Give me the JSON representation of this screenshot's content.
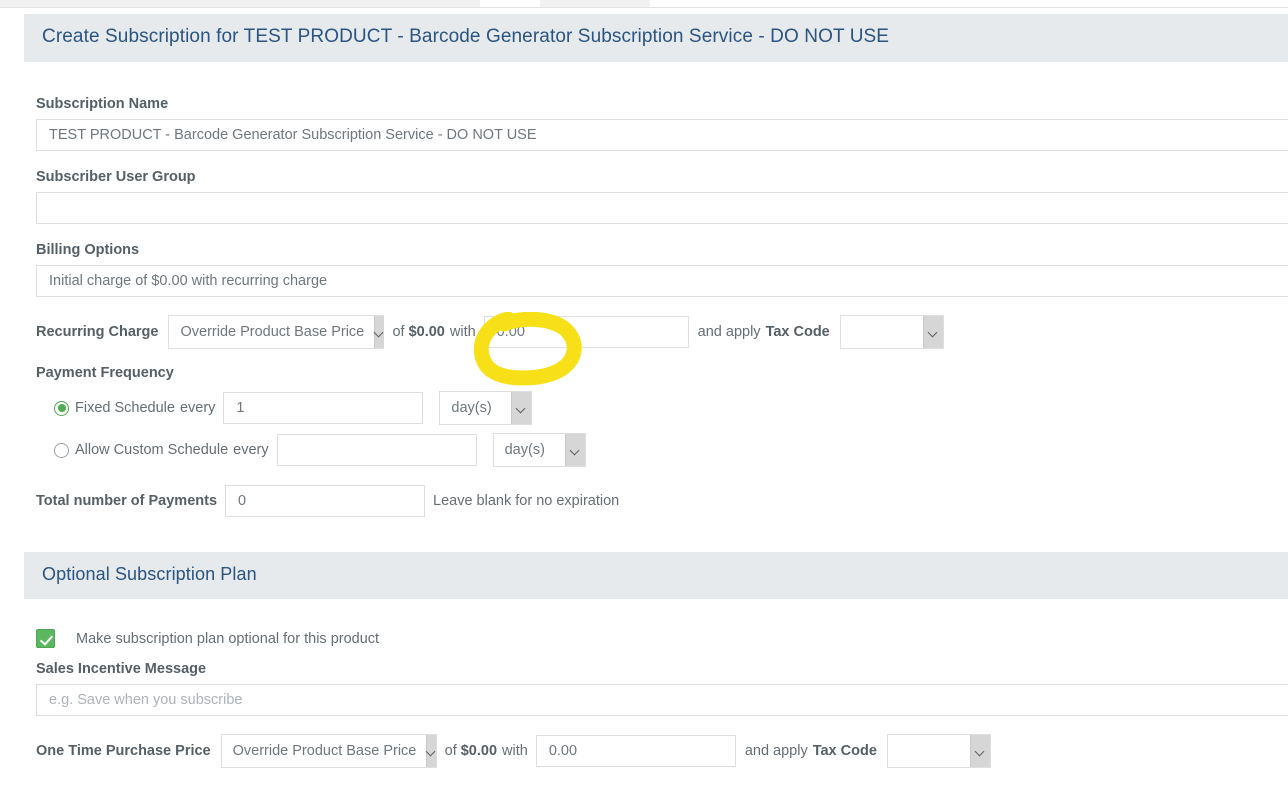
{
  "panel": {
    "title": "Create Subscription for TEST PRODUCT - Barcode Generator Subscription Service - DO NOT USE"
  },
  "fields": {
    "subscription_name": {
      "label": "Subscription Name",
      "value": "TEST PRODUCT - Barcode Generator Subscription Service - DO NOT USE"
    },
    "subscriber_user_group": {
      "label": "Subscriber User Group",
      "value": ""
    },
    "billing_options": {
      "label": "Billing Options",
      "value": "Initial charge of $0.00 with recurring charge"
    }
  },
  "recurring_charge": {
    "label": "Recurring Charge",
    "mode_select": "Override Product Base Price",
    "of_text": "of",
    "base_price": "$0.00",
    "with_text": "with",
    "amount_value": "0.00",
    "and_apply_text": "and apply",
    "tax_code_label": "Tax Code",
    "tax_code_value": ""
  },
  "payment_frequency": {
    "label": "Payment Frequency",
    "fixed": {
      "label": "Fixed Schedule",
      "every_text": "every",
      "selected": true,
      "interval_value": "1",
      "unit_select": "day(s)"
    },
    "custom": {
      "label": "Allow Custom Schedule",
      "every_text": "every",
      "selected": false,
      "interval_value": "",
      "unit_select": "day(s)"
    }
  },
  "total_payments": {
    "label": "Total number of Payments",
    "value": "0",
    "hint": "Leave blank for no expiration"
  },
  "optional_plan": {
    "section_title": "Optional Subscription Plan",
    "checkbox_label": "Make subscription plan optional for this product",
    "checkbox_checked": true,
    "sales_incentive": {
      "label": "Sales Incentive Message",
      "value": "",
      "placeholder": "e.g. Save when you subscribe"
    },
    "one_time_price": {
      "label": "One Time Purchase Price",
      "mode_select": "Override Product Base Price",
      "of_text": "of",
      "base_price": "$0.00",
      "with_text": "with",
      "amount_value": "0.00",
      "and_apply_text": "and apply",
      "tax_code_label": "Tax Code",
      "tax_code_value": ""
    }
  },
  "annotation": {
    "shape": "ellipse-highlight",
    "color": "#f7e017"
  },
  "colors": {
    "header_bg": "#e6eaed",
    "header_text": "#2a5481",
    "label_text": "#555f66",
    "accent_green": "#5cb860",
    "annotation_yellow": "#f7e017"
  }
}
